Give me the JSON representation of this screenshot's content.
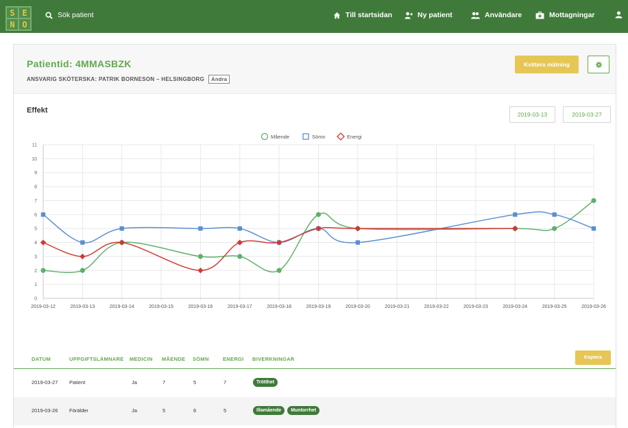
{
  "logo": [
    "S",
    "E",
    "N",
    "O"
  ],
  "nav": {
    "search_label": "Sök patient",
    "home_label": "Till startsidan",
    "new_patient_label": "Ny patient",
    "users_label": "Användare",
    "receptions_label": "Mottagningar"
  },
  "header": {
    "patient_id": "Patientid: 4MMASBZK",
    "nurse": "ANSVARIG SKÖTERSKA: PATRIK BORNESON – HELSINGBORG",
    "change_label": "Ändra",
    "confirm_label": "Kvittera mätning"
  },
  "section": {
    "title": "Effekt",
    "date_from": "2019-03-13",
    "date_to": "2019-03-27"
  },
  "chart_data": {
    "type": "line",
    "x": [
      "2019-03-12",
      "2019-03-13",
      "2019-03-14",
      "2019-03-15",
      "2019-03-16",
      "2019-03-17",
      "2019-03-18",
      "2019-03-19",
      "2019-03-20",
      "2019-03-21",
      "2019-03-22",
      "2019-03-23",
      "2019-03-24",
      "2019-03-25",
      "2019-03-26"
    ],
    "ylim": [
      0,
      11
    ],
    "yticks": [
      0,
      1,
      2,
      3,
      4,
      5,
      6,
      7,
      8,
      9,
      10,
      11
    ],
    "grid": true,
    "legend": "top-center",
    "series": [
      {
        "name": "Mående",
        "color": "#5fb06d",
        "marker": "circle",
        "values": [
          2,
          2,
          4,
          null,
          3,
          3,
          2,
          6,
          5,
          null,
          null,
          null,
          5,
          5,
          7
        ]
      },
      {
        "name": "Sömn",
        "color": "#5b8fd0",
        "marker": "square",
        "values": [
          6,
          4,
          5,
          null,
          5,
          5,
          4,
          5,
          4,
          null,
          null,
          null,
          6,
          6,
          5
        ]
      },
      {
        "name": "Energi",
        "color": "#d03a34",
        "marker": "diamond",
        "values": [
          4,
          3,
          4,
          null,
          2,
          4,
          4,
          5,
          5,
          null,
          null,
          null,
          5,
          null,
          null
        ]
      }
    ]
  },
  "table": {
    "headers": {
      "date": "DATUM",
      "reporter": "UPPGIFTSLÄMNARE",
      "medicine": "MEDICIN",
      "mood": "MÅENDE",
      "sleep": "SÖMN",
      "energy": "ENERGI",
      "side_effects": "BIVERKNINGAR"
    },
    "copy_label": "Kopiera",
    "rows": [
      {
        "date": "2019-03-27",
        "reporter": "Patient",
        "medicine": "Ja",
        "mood": "7",
        "sleep": "5",
        "energy": "7",
        "tags": [
          "Trötthet"
        ]
      },
      {
        "date": "2019-03-26",
        "reporter": "Förälder",
        "medicine": "Ja",
        "mood": "5",
        "sleep": "6",
        "energy": "5",
        "tags": [
          "Illamående",
          "Muntorrhet"
        ]
      }
    ]
  }
}
